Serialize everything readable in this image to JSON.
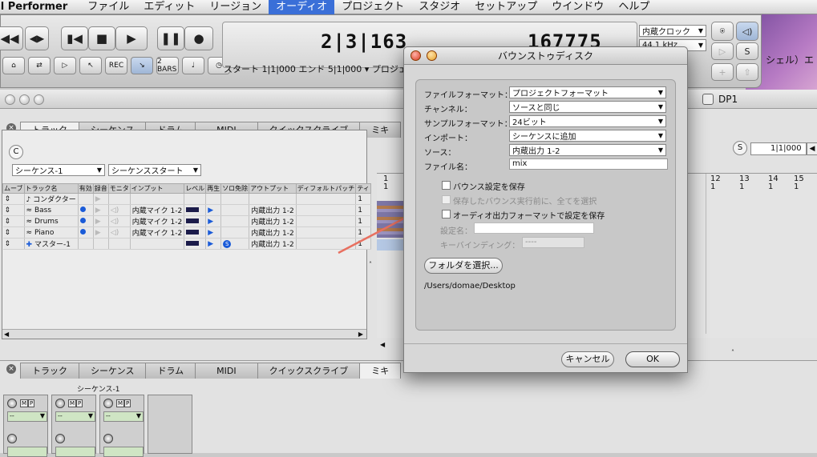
{
  "menubar": {
    "app": "al Performer",
    "items": [
      "ファイル",
      "エディット",
      "リージョン",
      "オーディオ",
      "プロジェクト",
      "スタジオ",
      "セットアップ",
      "ウインドウ",
      "ヘルプ"
    ],
    "active_index": 3
  },
  "transport": {
    "counter_measure": "2|3|163",
    "counter_samples": "167775",
    "start_end": "スタート 1|1|000 エンド 5|1|000 ▾ プロジェ",
    "clock_source": "内蔵クロック",
    "sample_rate": "44.1 kHz",
    "small_btn_rec": "REC",
    "small_btn_bars": "2 BARS"
  },
  "window": {
    "title": "DP1",
    "partial_text": "シェル）エ",
    "tabs": [
      "トラック",
      "シーケンス",
      "ドラム",
      "MIDI",
      "クイックスクライブ",
      "ミキ"
    ],
    "sequence_select": "シーケンス-1",
    "start_select": "シーケンススタート",
    "position": "1|1|000",
    "ruler_numbers": [
      "1",
      "12",
      "13",
      "14",
      "15"
    ],
    "ruler_sub": "1",
    "track_headers": [
      "ムーブ",
      "トラック名",
      "有効",
      "録音",
      "モニタ",
      "インプット",
      "レベル",
      "再生",
      "ソロ免除",
      "アウトプット",
      "ディフォルトパッチ",
      "ティ"
    ],
    "tracks": [
      {
        "name": "コンダクター",
        "input": "",
        "output": "",
        "col": "1"
      },
      {
        "name": "Bass",
        "input": "内蔵マイク 1-2",
        "output": "内蔵出力 1-2",
        "col": "1"
      },
      {
        "name": "Drums",
        "input": "内蔵マイク 1-2",
        "output": "内蔵出力 1-2",
        "col": "1"
      },
      {
        "name": "Piano",
        "input": "内蔵マイク 1-2",
        "output": "内蔵出力 1-2",
        "col": "1"
      },
      {
        "name": "マスター-1",
        "input": "",
        "output": "内蔵出力 1-2",
        "col": "1"
      }
    ],
    "bottom_tabs": [
      "トラック",
      "シーケンス",
      "ドラム",
      "MIDI",
      "クイックスクライブ",
      "ミキ"
    ],
    "mixer_title": "シーケンス-1"
  },
  "dialog": {
    "title": "バウンストゥディスク",
    "rows": [
      {
        "label": "ファイルフォーマット：",
        "value": "プロジェクトフォーマット"
      },
      {
        "label": "チャンネル：",
        "value": "ソースと同じ"
      },
      {
        "label": "サンプルフォーマット：",
        "value": "24ビット"
      },
      {
        "label": "インポート：",
        "value": "シーケンスに追加"
      },
      {
        "label": "ソース：",
        "value": "内蔵出力 1-2"
      }
    ],
    "filename_label": "ファイル名：",
    "filename_value": "mix",
    "check_save_bounce": "バウンス設定を保存",
    "check_select_all": "保存したバウンス実行前に、全てを選択",
    "check_save_audio": "オーディオ出力フォーマットで設定を保存",
    "setting_name_label": "設定名：",
    "key_binding_label": "キーバインディング：",
    "key_binding_value": "----",
    "folder_button": "フォルダを選択...",
    "path": "/Users/domae/Desktop",
    "cancel": "キャンセル",
    "ok": "OK"
  },
  "colors": {
    "accent": "#3a6fd8",
    "arrow": "#e87060",
    "menu_active": "#3a6fd8"
  }
}
